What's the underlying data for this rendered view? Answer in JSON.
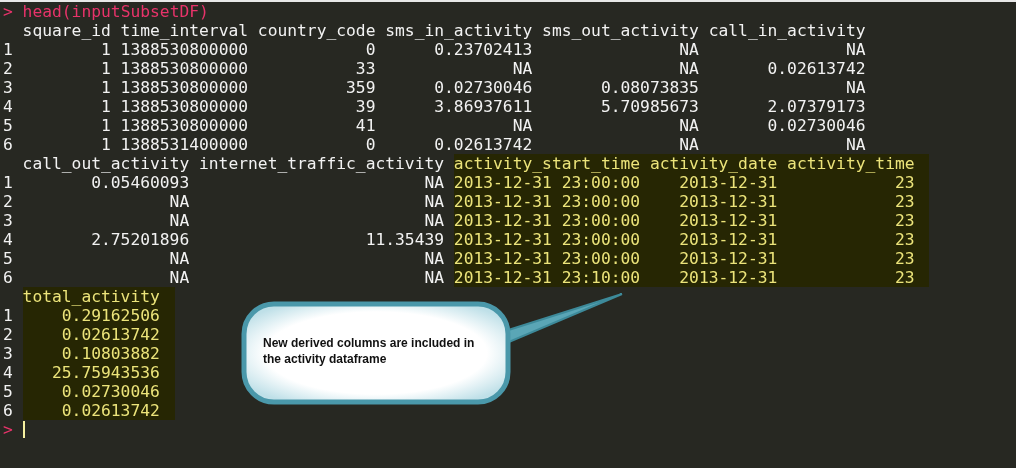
{
  "console": {
    "command": {
      "prompt": ">",
      "text": "head(inputSubsetDF)"
    },
    "blocks": [
      {
        "row_labels": [
          "1",
          "2",
          "3",
          "4",
          "5",
          "6"
        ],
        "columns": [
          {
            "header": "square_id",
            "highlighted": false,
            "cells": [
              "1",
              "1",
              "1",
              "1",
              "1",
              "1"
            ]
          },
          {
            "header": "time_interval",
            "highlighted": false,
            "cells": [
              "1388530800000",
              "1388530800000",
              "1388530800000",
              "1388530800000",
              "1388530800000",
              "1388531400000"
            ]
          },
          {
            "header": "country_code",
            "highlighted": false,
            "cells": [
              "0",
              "33",
              "359",
              "39",
              "41",
              "0"
            ]
          },
          {
            "header": "sms_in_activity",
            "highlighted": false,
            "cells": [
              "0.23702413",
              "NA",
              "0.02730046",
              "3.86937611",
              "NA",
              "0.02613742"
            ]
          },
          {
            "header": "sms_out_activity",
            "highlighted": false,
            "cells": [
              "NA",
              "NA",
              "0.08073835",
              "5.70985673",
              "NA",
              "NA"
            ]
          },
          {
            "header": "call_in_activity",
            "highlighted": false,
            "cells": [
              "NA",
              "0.02613742",
              "NA",
              "2.07379173",
              "0.02730046",
              "NA"
            ]
          }
        ]
      },
      {
        "row_labels": [
          "1",
          "2",
          "3",
          "4",
          "5",
          "6"
        ],
        "columns": [
          {
            "header": "call_out_activity",
            "highlighted": false,
            "cells": [
              "0.05460093",
              "NA",
              "NA",
              "2.75201896",
              "NA",
              "NA"
            ]
          },
          {
            "header": "internet_traffic_activity",
            "highlighted": false,
            "cells": [
              "NA",
              "NA",
              "NA",
              "11.35439",
              "NA",
              "NA"
            ]
          },
          {
            "header": "activity_start_time",
            "highlighted": true,
            "cells": [
              "2013-12-31 23:00:00",
              "2013-12-31 23:00:00",
              "2013-12-31 23:00:00",
              "2013-12-31 23:00:00",
              "2013-12-31 23:00:00",
              "2013-12-31 23:10:00"
            ]
          },
          {
            "header": "activity_date",
            "highlighted": true,
            "cells": [
              "2013-12-31",
              "2013-12-31",
              "2013-12-31",
              "2013-12-31",
              "2013-12-31",
              "2013-12-31"
            ]
          },
          {
            "header": "activity_time",
            "highlighted": true,
            "cells": [
              "23",
              "23",
              "23",
              "23",
              "23",
              "23"
            ]
          }
        ]
      },
      {
        "row_labels": [
          "1",
          "2",
          "3",
          "4",
          "5",
          "6"
        ],
        "columns": [
          {
            "header": "total_activity",
            "highlighted": true,
            "cells": [
              "0.29162506",
              "0.02613742",
              "0.10803882",
              "25.75943536",
              "0.02730046",
              "0.02613742"
            ]
          }
        ]
      }
    ],
    "input_prompt": ">"
  },
  "callout": {
    "text": "New derived columns are included in the activity dataframe"
  }
}
